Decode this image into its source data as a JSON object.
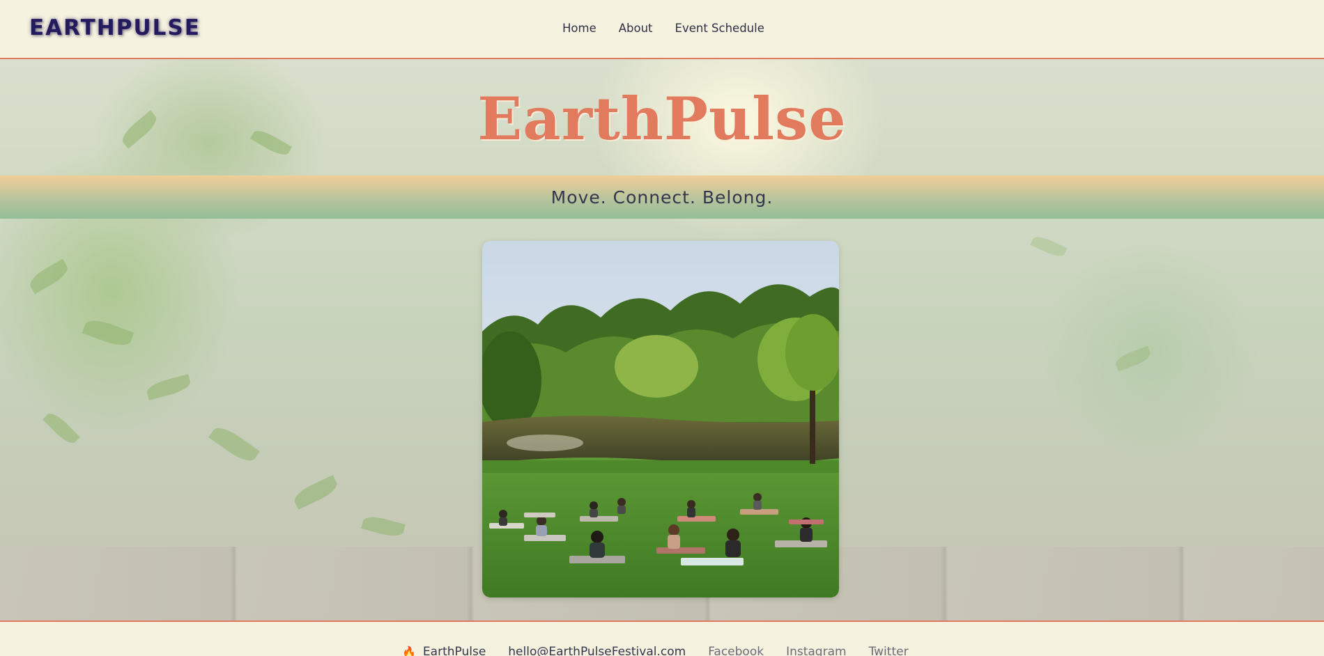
{
  "header": {
    "brand": "EARTHPULSE",
    "nav": [
      "Home",
      "About",
      "Event Schedule"
    ]
  },
  "hero": {
    "title": "EarthPulse",
    "tagline": "Move. Connect. Belong."
  },
  "footer": {
    "icon": "flame-icon",
    "brand": "EarthPulse",
    "email": "hello@EarthPulseFestival.com",
    "links": [
      "Facebook",
      "Instagram",
      "Twitter"
    ]
  },
  "colors": {
    "accent": "#e27a5e",
    "brand_text": "#241b5e",
    "background": "#f5f1df"
  }
}
